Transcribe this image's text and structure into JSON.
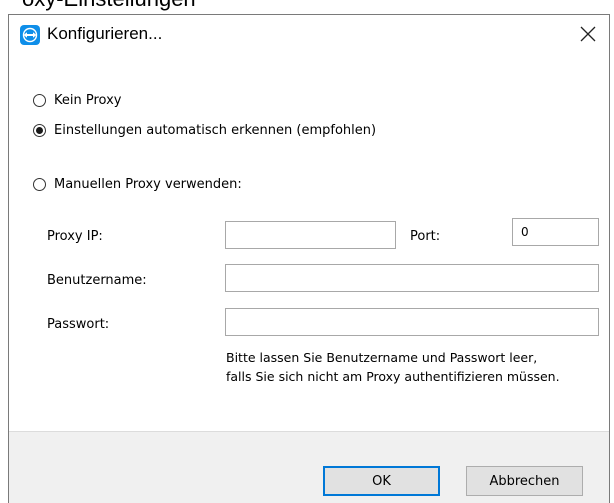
{
  "window": {
    "cropped_heading": "oxy-Einstellungen",
    "title": "Konfigurieren...",
    "icon": "teamviewer-icon",
    "close_icon": "close-icon"
  },
  "proxy_options": [
    {
      "label": "Kein Proxy",
      "selected": false
    },
    {
      "label": "Einstellungen automatisch erkennen (empfohlen)",
      "selected": true
    },
    {
      "label": "Manuellen Proxy verwenden:",
      "selected": false
    }
  ],
  "fields": {
    "proxy_ip_label": "Proxy IP:",
    "proxy_ip_value": "",
    "port_label": "Port:",
    "port_value": "0",
    "username_label": "Benutzername:",
    "username_value": "",
    "password_label": "Passwort:",
    "password_value": ""
  },
  "hint": {
    "line1": "Bitte lassen Sie Benutzername und Passwort leer,",
    "line2": "falls Sie sich nicht am Proxy authentifizieren müssen."
  },
  "buttons": {
    "ok": "OK",
    "cancel": "Abbrechen"
  },
  "colors": {
    "accent": "#0078d7",
    "icon_blue": "#0e8ee9",
    "footer_bg": "#f0f0f0"
  }
}
